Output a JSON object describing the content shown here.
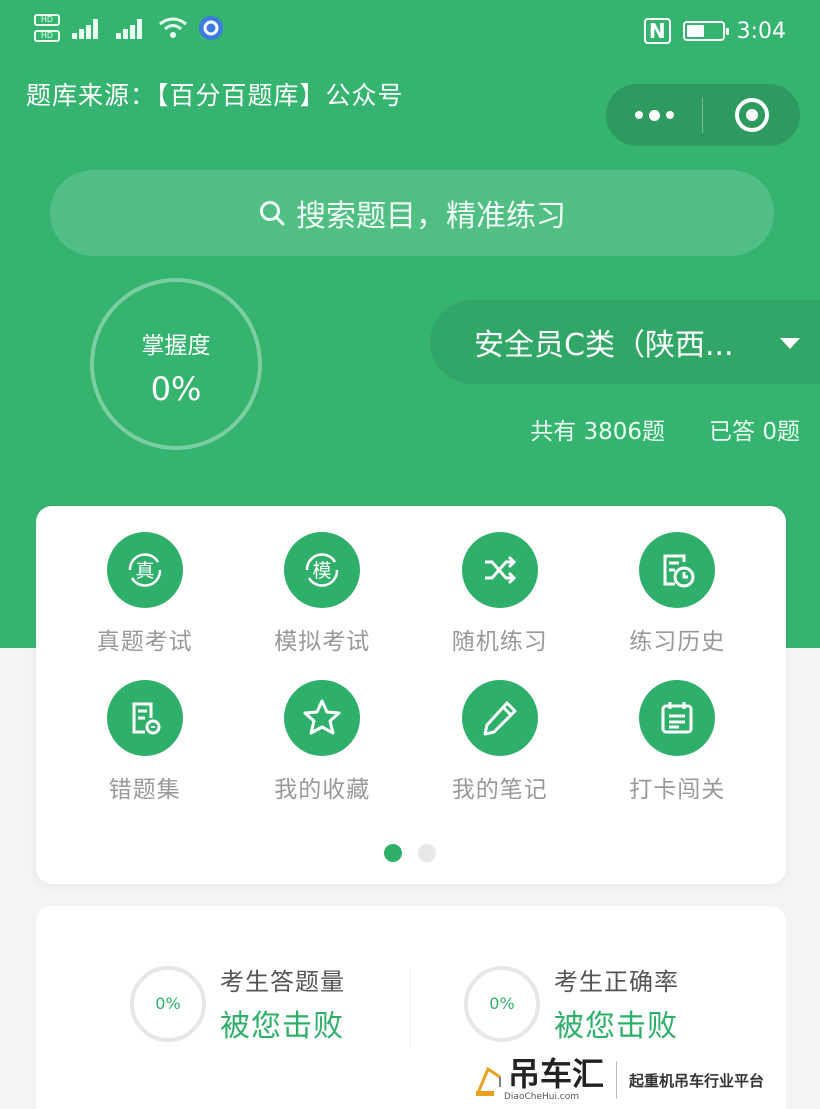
{
  "status_bar": {
    "sim_labels": [
      "HD",
      "HD"
    ],
    "network": [
      "4G",
      "4G"
    ],
    "battery_level": 0.5,
    "nfc_label": "N",
    "time": "3:04"
  },
  "header": {
    "source_text": "题库来源：【百分百题库】公众号"
  },
  "search": {
    "placeholder": "搜索题目，精准练习"
  },
  "mastery": {
    "label": "掌握度",
    "value": "0%"
  },
  "category": {
    "selected": "安全员C类（陕西..."
  },
  "counts": {
    "total": "共有 3806题",
    "answered": "已答 0题"
  },
  "menu": {
    "items": [
      {
        "label": "真题考试",
        "icon": "exam-icon"
      },
      {
        "label": "模拟考试",
        "icon": "mock-icon"
      },
      {
        "label": "随机练习",
        "icon": "shuffle-icon"
      },
      {
        "label": "练习历史",
        "icon": "history-icon"
      },
      {
        "label": "错题集",
        "icon": "wrong-book-icon"
      },
      {
        "label": "我的收藏",
        "icon": "star-icon"
      },
      {
        "label": "我的笔记",
        "icon": "pencil-icon"
      },
      {
        "label": "打卡闯关",
        "icon": "calendar-icon"
      }
    ],
    "page_index": 1,
    "page_count": 2,
    "icon_glyph_exam": "真",
    "icon_glyph_mock": "模"
  },
  "stats": [
    {
      "ring_value": "0%",
      "title": "考生答题量",
      "subtitle": "被您击败"
    },
    {
      "ring_value": "0%",
      "title": "考生正确率",
      "subtitle": "被您击败"
    }
  ],
  "watermark": {
    "name": "吊车汇",
    "url": "DiaoCheHui.com",
    "slogan": "起重机吊车行业平台"
  },
  "colors": {
    "brand_green": "#35b46f",
    "icon_green": "#2fb06a"
  }
}
